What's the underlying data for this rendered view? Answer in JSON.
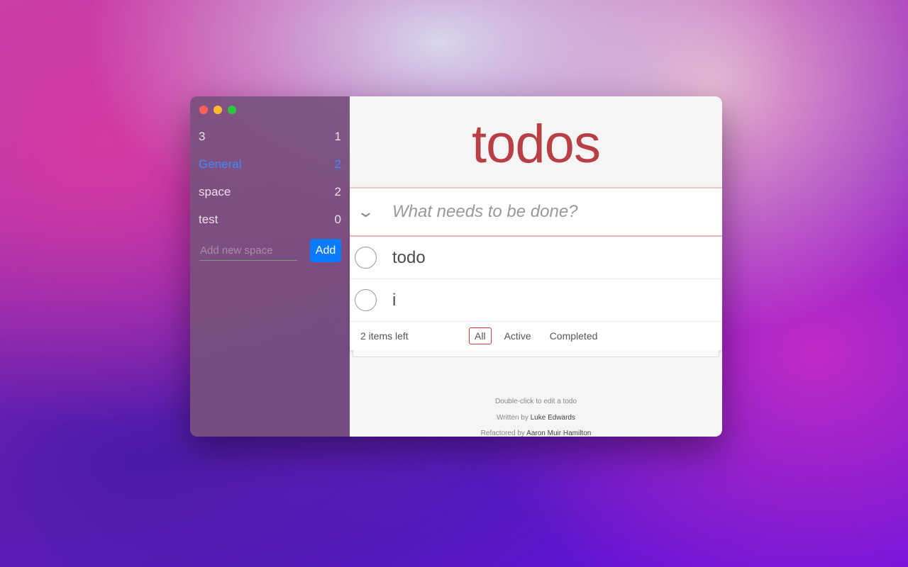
{
  "sidebar": {
    "spaces": [
      {
        "name": "3",
        "count": "1"
      },
      {
        "name": "General",
        "count": "2",
        "active": true
      },
      {
        "name": "space",
        "count": "2"
      },
      {
        "name": "test",
        "count": "0"
      }
    ],
    "add_placeholder": "Add new space",
    "add_label": "Add"
  },
  "colors": {
    "close": "#ff5f57",
    "minimize": "#febc2e",
    "zoom": "#28c840",
    "accent": "#0a7bff",
    "title": "#b83f45"
  },
  "main": {
    "title": "todos",
    "new_placeholder": "What needs to be done?",
    "todos": [
      {
        "text": "todo",
        "completed": false
      },
      {
        "text": "i",
        "completed": false
      }
    ],
    "items_left": "2 items left",
    "filters": [
      "All",
      "Active",
      "Completed"
    ],
    "selected_filter": "All"
  },
  "info": {
    "hint": "Double-click to edit a todo",
    "written_prefix": "Written by",
    "written_name": "Luke Edwards",
    "refactored_prefix": "Refactored by",
    "refactored_name": "Aaron Muir Hamilton"
  }
}
